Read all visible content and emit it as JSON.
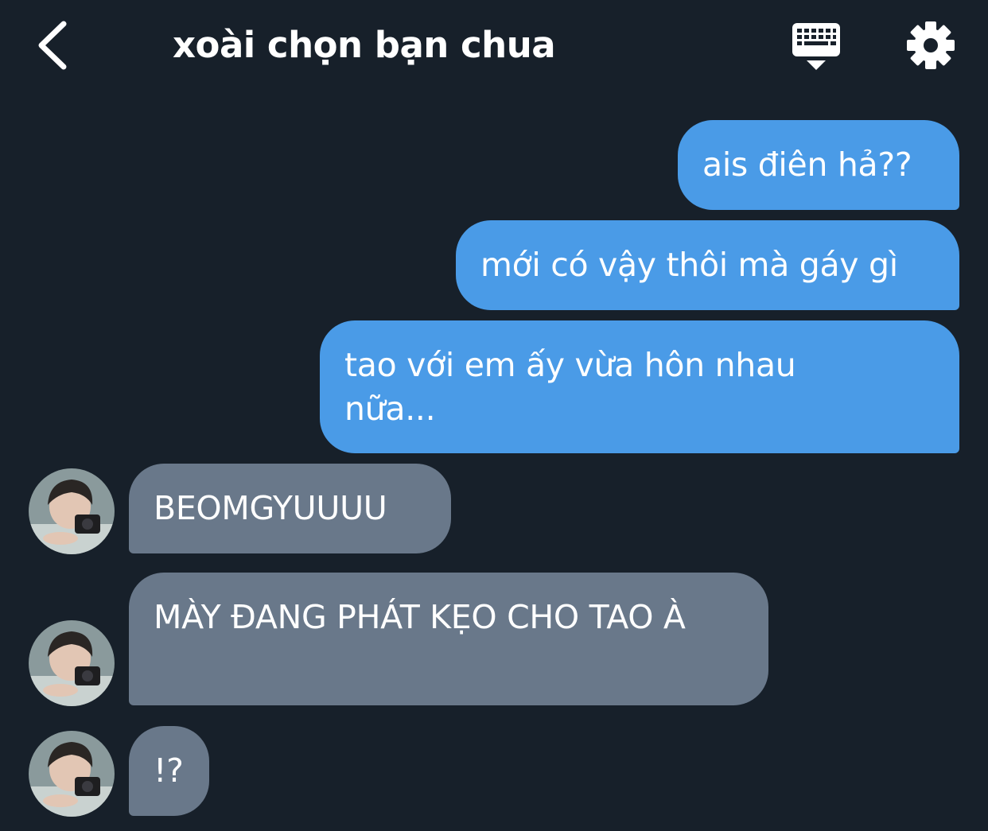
{
  "header": {
    "title": "xoài chọn bạn chua"
  },
  "messages": [
    {
      "direction": "out",
      "text": "ais điên hả??"
    },
    {
      "direction": "out",
      "text": "mới có vậy thôi mà gáy gì"
    },
    {
      "direction": "out",
      "text": "tao với em ấy vừa hôn nhau nữa..."
    },
    {
      "direction": "in",
      "text": "BEOMGYUUUU"
    },
    {
      "direction": "in",
      "text": "MÀY ĐANG PHÁT KẸO CHO TAO À"
    },
    {
      "direction": "in",
      "text": "!?"
    }
  ],
  "colors": {
    "background": "#17202a",
    "outgoing_bubble": "#4a9be7",
    "incoming_bubble": "#69788a",
    "text": "#ffffff"
  },
  "icons": {
    "back": "chevron-left-icon",
    "keyboard": "keyboard-icon",
    "settings": "gear-icon"
  }
}
